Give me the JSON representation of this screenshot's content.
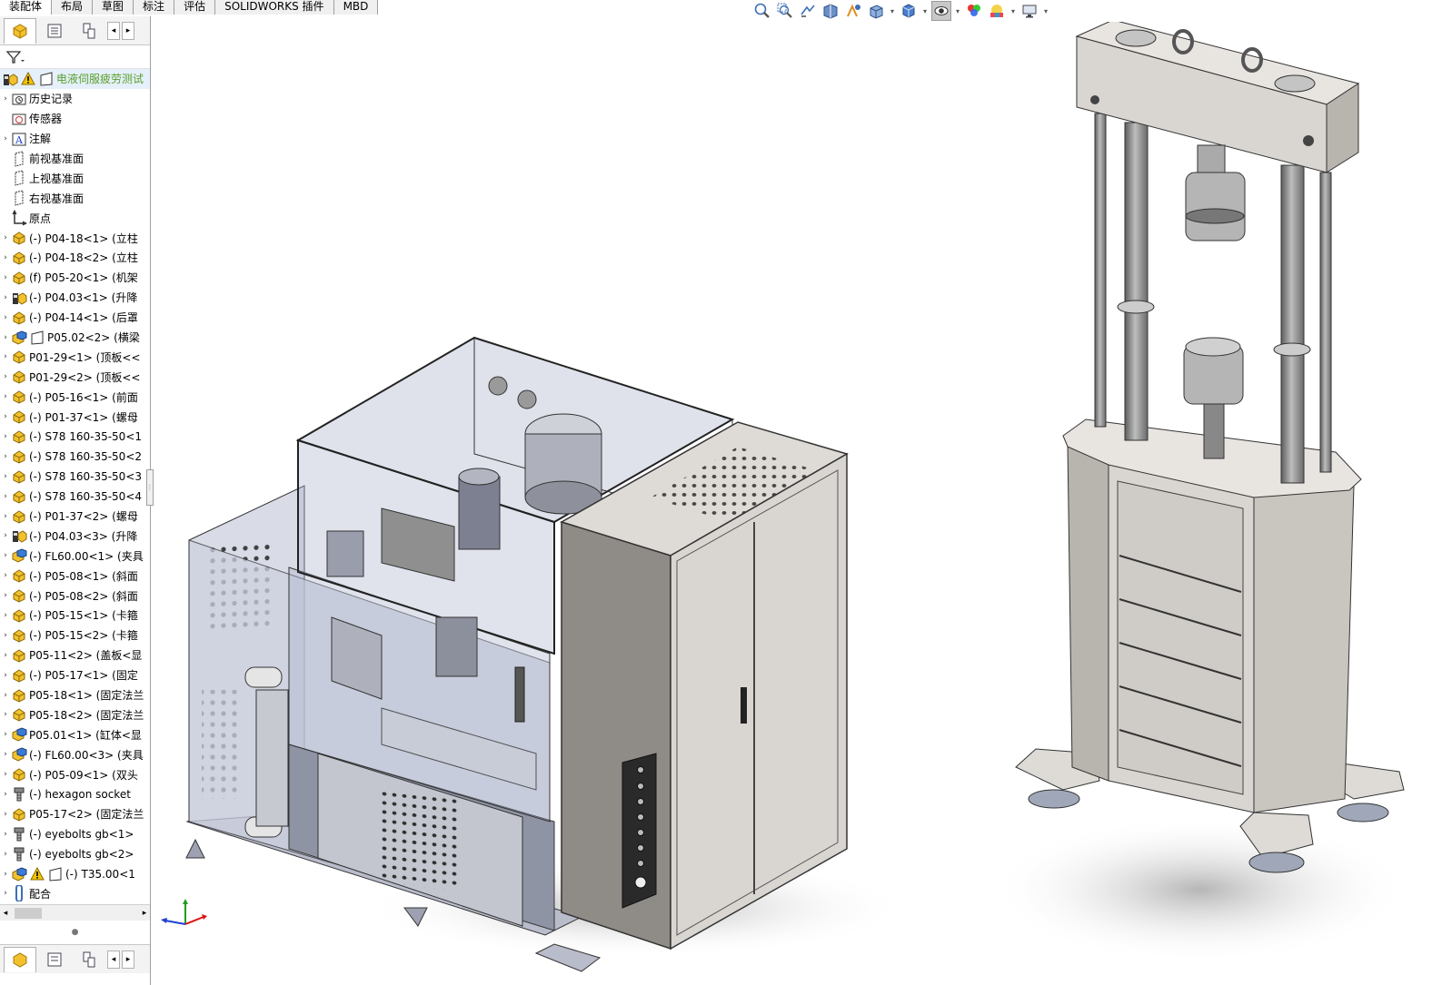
{
  "command_tabs": [
    "装配体",
    "布局",
    "草图",
    "标注",
    "评估",
    "SOLIDWORKS 插件",
    "MBD"
  ],
  "active_tab_index": 0,
  "hud_icons": [
    "zoom-to-fit-icon",
    "zoom-to-area-icon",
    "previous-view-icon",
    "section-view-icon",
    "dynamic-annotation-icon",
    "view-orientation-icon",
    "display-style-icon",
    "hide-show-items-icon",
    "edit-appearance-icon",
    "apply-scene-icon",
    "view-settings-icon"
  ],
  "feature_tree": {
    "root": {
      "label": "电液伺服疲劳测试",
      "warning": true
    },
    "items": [
      {
        "label": "历史记录",
        "icon": "history-folder-icon",
        "expandable": true
      },
      {
        "label": "传感器",
        "icon": "sensor-folder-icon",
        "expandable": false
      },
      {
        "label": "注解",
        "icon": "annotation-folder-icon",
        "expandable": true
      },
      {
        "label": "前视基准面",
        "icon": "plane-icon",
        "expandable": false
      },
      {
        "label": "上视基准面",
        "icon": "plane-icon",
        "expandable": false
      },
      {
        "label": "右视基准面",
        "icon": "plane-icon",
        "expandable": false
      },
      {
        "label": "原点",
        "icon": "origin-icon",
        "expandable": false
      },
      {
        "label": "(-) P04-18<1> (立柱",
        "icon": "part-icon",
        "expandable": true
      },
      {
        "label": "(-) P04-18<2> (立柱",
        "icon": "part-icon",
        "expandable": true
      },
      {
        "label": "(f) P05-20<1> (机架",
        "icon": "part-icon",
        "expandable": true
      },
      {
        "label": "(-) P04.03<1> (升降",
        "icon": "subassembly-icon",
        "expandable": true
      },
      {
        "label": "(-) P04-14<1> (后罩",
        "icon": "part-icon",
        "expandable": true
      },
      {
        "label": "P05.02<2> (横梁",
        "icon": "assembly-icon",
        "expandable": true
      },
      {
        "label": "P01-29<1> (顶板<<",
        "icon": "part-icon",
        "expandable": true
      },
      {
        "label": "P01-29<2> (顶板<<",
        "icon": "part-icon",
        "expandable": true
      },
      {
        "label": "(-) P05-16<1> (前面",
        "icon": "part-icon",
        "expandable": true
      },
      {
        "label": "(-) P01-37<1> (螺母",
        "icon": "part-icon",
        "expandable": true
      },
      {
        "label": "(-) S78 160-35-50<1",
        "icon": "part-icon",
        "expandable": true
      },
      {
        "label": "(-) S78 160-35-50<2",
        "icon": "part-icon",
        "expandable": true
      },
      {
        "label": "(-) S78 160-35-50<3",
        "icon": "part-icon",
        "expandable": true
      },
      {
        "label": "(-) S78 160-35-50<4",
        "icon": "part-icon",
        "expandable": true
      },
      {
        "label": "(-) P01-37<2> (螺母",
        "icon": "part-icon",
        "expandable": true
      },
      {
        "label": "(-) P04.03<3> (升降",
        "icon": "subassembly-icon",
        "expandable": true
      },
      {
        "label": "(-) FL60.00<1> (夹具",
        "icon": "assembly-icon",
        "expandable": true
      },
      {
        "label": "(-) P05-08<1> (斜面",
        "icon": "part-icon",
        "expandable": true
      },
      {
        "label": "(-) P05-08<2> (斜面",
        "icon": "part-icon",
        "expandable": true
      },
      {
        "label": "(-) P05-15<1> (卡箍",
        "icon": "part-icon",
        "expandable": true
      },
      {
        "label": "(-) P05-15<2> (卡箍",
        "icon": "part-icon",
        "expandable": true
      },
      {
        "label": "P05-11<2> (盖板<显",
        "icon": "part-icon",
        "expandable": true
      },
      {
        "label": "(-) P05-17<1> (固定",
        "icon": "part-icon",
        "expandable": true
      },
      {
        "label": "P05-18<1> (固定法兰",
        "icon": "part-icon",
        "expandable": true
      },
      {
        "label": "P05-18<2> (固定法兰",
        "icon": "part-icon",
        "expandable": true
      },
      {
        "label": "P05.01<1> (缸体<显",
        "icon": "assembly-icon",
        "expandable": true
      },
      {
        "label": "(-) FL60.00<3> (夹具",
        "icon": "assembly-icon",
        "expandable": true
      },
      {
        "label": "(-) P05-09<1> (双头",
        "icon": "part-icon",
        "expandable": true
      },
      {
        "label": "(-) hexagon socket",
        "icon": "toolbox-bolt-icon",
        "expandable": true
      },
      {
        "label": "P05-17<2> (固定法兰",
        "icon": "part-icon",
        "expandable": true
      },
      {
        "label": "(-) eyebolts gb<1>",
        "icon": "toolbox-bolt-icon",
        "expandable": true
      },
      {
        "label": "(-) eyebolts gb<2>",
        "icon": "toolbox-bolt-icon",
        "expandable": true
      },
      {
        "label": "(-) T35.00<1",
        "icon": "assembly-warning-icon",
        "expandable": true
      },
      {
        "label": "配合",
        "icon": "mates-icon",
        "expandable": true
      }
    ]
  },
  "colors": {
    "accent_root": "#5aa02c",
    "part_yellow": "#f2c12e",
    "assembly_blue": "#3a7bd5",
    "cabinet_light": "#d9d6d2",
    "cabinet_dark": "#8f8b86",
    "glass": "#a7b0c8"
  }
}
